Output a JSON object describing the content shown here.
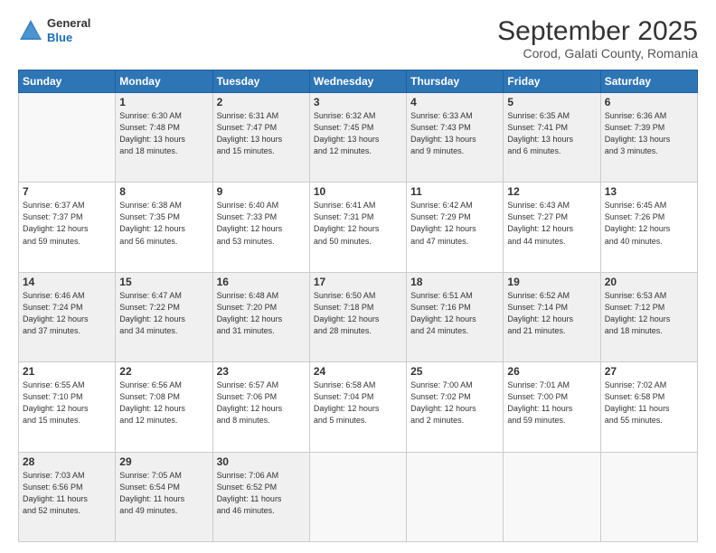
{
  "header": {
    "logo_line1": "General",
    "logo_line2": "Blue",
    "month": "September 2025",
    "location": "Corod, Galati County, Romania"
  },
  "weekdays": [
    "Sunday",
    "Monday",
    "Tuesday",
    "Wednesday",
    "Thursday",
    "Friday",
    "Saturday"
  ],
  "weeks": [
    [
      {
        "day": "",
        "info": ""
      },
      {
        "day": "1",
        "info": "Sunrise: 6:30 AM\nSunset: 7:48 PM\nDaylight: 13 hours\nand 18 minutes."
      },
      {
        "day": "2",
        "info": "Sunrise: 6:31 AM\nSunset: 7:47 PM\nDaylight: 13 hours\nand 15 minutes."
      },
      {
        "day": "3",
        "info": "Sunrise: 6:32 AM\nSunset: 7:45 PM\nDaylight: 13 hours\nand 12 minutes."
      },
      {
        "day": "4",
        "info": "Sunrise: 6:33 AM\nSunset: 7:43 PM\nDaylight: 13 hours\nand 9 minutes."
      },
      {
        "day": "5",
        "info": "Sunrise: 6:35 AM\nSunset: 7:41 PM\nDaylight: 13 hours\nand 6 minutes."
      },
      {
        "day": "6",
        "info": "Sunrise: 6:36 AM\nSunset: 7:39 PM\nDaylight: 13 hours\nand 3 minutes."
      }
    ],
    [
      {
        "day": "7",
        "info": "Sunrise: 6:37 AM\nSunset: 7:37 PM\nDaylight: 12 hours\nand 59 minutes."
      },
      {
        "day": "8",
        "info": "Sunrise: 6:38 AM\nSunset: 7:35 PM\nDaylight: 12 hours\nand 56 minutes."
      },
      {
        "day": "9",
        "info": "Sunrise: 6:40 AM\nSunset: 7:33 PM\nDaylight: 12 hours\nand 53 minutes."
      },
      {
        "day": "10",
        "info": "Sunrise: 6:41 AM\nSunset: 7:31 PM\nDaylight: 12 hours\nand 50 minutes."
      },
      {
        "day": "11",
        "info": "Sunrise: 6:42 AM\nSunset: 7:29 PM\nDaylight: 12 hours\nand 47 minutes."
      },
      {
        "day": "12",
        "info": "Sunrise: 6:43 AM\nSunset: 7:27 PM\nDaylight: 12 hours\nand 44 minutes."
      },
      {
        "day": "13",
        "info": "Sunrise: 6:45 AM\nSunset: 7:26 PM\nDaylight: 12 hours\nand 40 minutes."
      }
    ],
    [
      {
        "day": "14",
        "info": "Sunrise: 6:46 AM\nSunset: 7:24 PM\nDaylight: 12 hours\nand 37 minutes."
      },
      {
        "day": "15",
        "info": "Sunrise: 6:47 AM\nSunset: 7:22 PM\nDaylight: 12 hours\nand 34 minutes."
      },
      {
        "day": "16",
        "info": "Sunrise: 6:48 AM\nSunset: 7:20 PM\nDaylight: 12 hours\nand 31 minutes."
      },
      {
        "day": "17",
        "info": "Sunrise: 6:50 AM\nSunset: 7:18 PM\nDaylight: 12 hours\nand 28 minutes."
      },
      {
        "day": "18",
        "info": "Sunrise: 6:51 AM\nSunset: 7:16 PM\nDaylight: 12 hours\nand 24 minutes."
      },
      {
        "day": "19",
        "info": "Sunrise: 6:52 AM\nSunset: 7:14 PM\nDaylight: 12 hours\nand 21 minutes."
      },
      {
        "day": "20",
        "info": "Sunrise: 6:53 AM\nSunset: 7:12 PM\nDaylight: 12 hours\nand 18 minutes."
      }
    ],
    [
      {
        "day": "21",
        "info": "Sunrise: 6:55 AM\nSunset: 7:10 PM\nDaylight: 12 hours\nand 15 minutes."
      },
      {
        "day": "22",
        "info": "Sunrise: 6:56 AM\nSunset: 7:08 PM\nDaylight: 12 hours\nand 12 minutes."
      },
      {
        "day": "23",
        "info": "Sunrise: 6:57 AM\nSunset: 7:06 PM\nDaylight: 12 hours\nand 8 minutes."
      },
      {
        "day": "24",
        "info": "Sunrise: 6:58 AM\nSunset: 7:04 PM\nDaylight: 12 hours\nand 5 minutes."
      },
      {
        "day": "25",
        "info": "Sunrise: 7:00 AM\nSunset: 7:02 PM\nDaylight: 12 hours\nand 2 minutes."
      },
      {
        "day": "26",
        "info": "Sunrise: 7:01 AM\nSunset: 7:00 PM\nDaylight: 11 hours\nand 59 minutes."
      },
      {
        "day": "27",
        "info": "Sunrise: 7:02 AM\nSunset: 6:58 PM\nDaylight: 11 hours\nand 55 minutes."
      }
    ],
    [
      {
        "day": "28",
        "info": "Sunrise: 7:03 AM\nSunset: 6:56 PM\nDaylight: 11 hours\nand 52 minutes."
      },
      {
        "day": "29",
        "info": "Sunrise: 7:05 AM\nSunset: 6:54 PM\nDaylight: 11 hours\nand 49 minutes."
      },
      {
        "day": "30",
        "info": "Sunrise: 7:06 AM\nSunset: 6:52 PM\nDaylight: 11 hours\nand 46 minutes."
      },
      {
        "day": "",
        "info": ""
      },
      {
        "day": "",
        "info": ""
      },
      {
        "day": "",
        "info": ""
      },
      {
        "day": "",
        "info": ""
      }
    ]
  ]
}
